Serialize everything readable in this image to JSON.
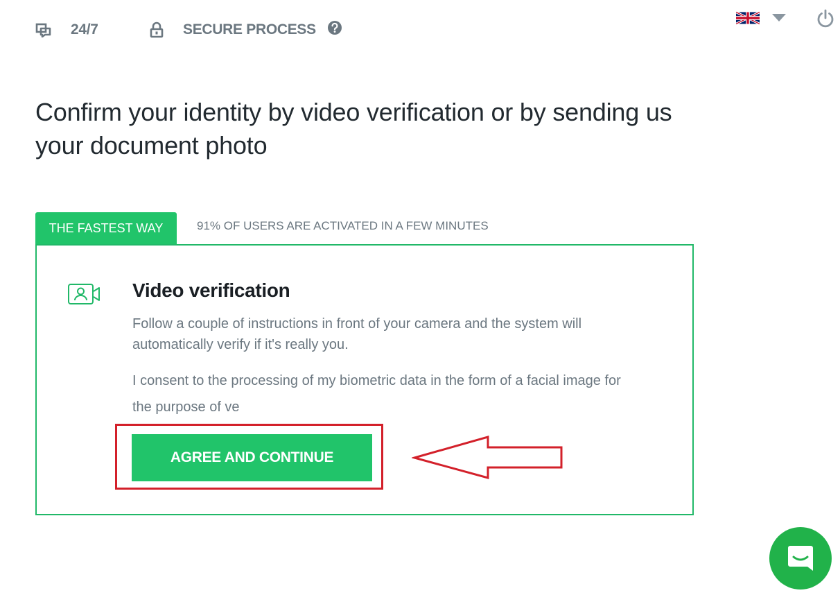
{
  "topbar": {
    "support_hours": "24/7",
    "secure_label": "SECURE PROCESS"
  },
  "colors": {
    "accent": "#21c46a",
    "border": "#21b868",
    "annotation_red": "#d3202a",
    "chat": "#21b24a"
  },
  "icons": {
    "chat": "chat-bubbles-icon",
    "lock": "lock-icon",
    "help": "question-circle-icon",
    "language": "uk-flag-icon",
    "dropdown": "caret-down-icon",
    "power": "power-icon",
    "video": "video-camera-user-icon",
    "messenger": "messenger-icon"
  },
  "heading": "Confirm your identity by video verification or by sending us your document photo",
  "tabs": {
    "fastest": "THE FASTEST WAY",
    "note": "91% OF USERS ARE ACTIVATED IN A FEW MINUTES"
  },
  "card": {
    "title": "Video verification",
    "description": "Follow a couple of instructions in front of your camera and the system will automatically verify if it's really you.",
    "consent": "I consent to the processing of my biometric data in the form of a facial image for the purpose of ve",
    "button_label": "AGREE AND CONTINUE"
  }
}
